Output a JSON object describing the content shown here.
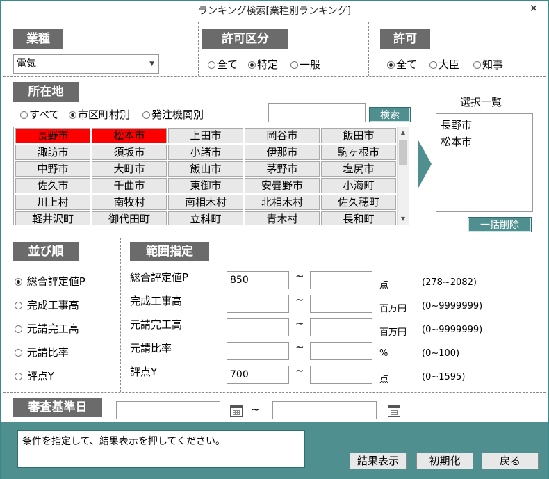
{
  "window": {
    "title": "ランキング検索[業種別ランキング]",
    "close_glyph": "✕"
  },
  "gyoshu": {
    "header": "業種",
    "selected": "電気"
  },
  "kyoka_kubun": {
    "header": "許可区分",
    "options": [
      {
        "label": "全て",
        "checked": false
      },
      {
        "label": "特定",
        "checked": true
      },
      {
        "label": "一般",
        "checked": false
      }
    ]
  },
  "kyoka": {
    "header": "許可",
    "options": [
      {
        "label": "全て",
        "checked": true
      },
      {
        "label": "大臣",
        "checked": false
      },
      {
        "label": "知事",
        "checked": false
      }
    ]
  },
  "shozaichi": {
    "header": "所在地",
    "modes": [
      {
        "label": "すべて",
        "checked": false
      },
      {
        "label": "市区町村別",
        "checked": true
      },
      {
        "label": "発注機関別",
        "checked": false
      }
    ],
    "search_value": "",
    "search_button": "検索",
    "cities": [
      [
        "長野市",
        "松本市",
        "上田市",
        "岡谷市",
        "飯田市"
      ],
      [
        "諏訪市",
        "須坂市",
        "小諸市",
        "伊那市",
        "駒ヶ根市"
      ],
      [
        "中野市",
        "大町市",
        "飯山市",
        "茅野市",
        "塩尻市"
      ],
      [
        "佐久市",
        "千曲市",
        "東御市",
        "安曇野市",
        "小海町"
      ],
      [
        "川上村",
        "南牧村",
        "南相木村",
        "北相木村",
        "佐久穂町"
      ],
      [
        "軽井沢町",
        "御代田町",
        "立科町",
        "青木村",
        "長和町"
      ]
    ],
    "selected_cities": [
      "長野市",
      "松本市"
    ]
  },
  "selection_list": {
    "title": "選択一覧",
    "items": [
      "長野市",
      "松本市"
    ],
    "clear_button": "一括削除"
  },
  "sort": {
    "header": "並び順",
    "options": [
      {
        "label": "総合評定値P",
        "checked": true
      },
      {
        "label": "完成工事高",
        "checked": false
      },
      {
        "label": "元請完工高",
        "checked": false
      },
      {
        "label": "元請比率",
        "checked": false
      },
      {
        "label": "評点Y",
        "checked": false
      }
    ]
  },
  "range": {
    "header": "範囲指定",
    "tilde": "~",
    "rows": [
      {
        "label": "総合評定値P",
        "from": "850",
        "to": "",
        "unit": "点",
        "hint": "(278~2082)"
      },
      {
        "label": "完成工事高",
        "from": "",
        "to": "",
        "unit": "百万円",
        "hint": "(0~9999999)"
      },
      {
        "label": "元請完工高",
        "from": "",
        "to": "",
        "unit": "百万円",
        "hint": "(0~9999999)"
      },
      {
        "label": "元請比率",
        "from": "",
        "to": "",
        "unit": "%",
        "hint": "(0~100)"
      },
      {
        "label": "評点Y",
        "from": "700",
        "to": "",
        "unit": "点",
        "hint": "(0~1595)"
      }
    ]
  },
  "review_date": {
    "header": "審査基準日",
    "from": "",
    "to": "",
    "tilde": "~"
  },
  "footer": {
    "message": "条件を指定して、結果表示を押してください。",
    "buttons": {
      "show": "結果表示",
      "reset": "初期化",
      "back": "戻る"
    }
  },
  "colors": {
    "accent": "#4f8f8f",
    "header_bg": "#6b6b6b",
    "selected_cell": "#ff0000"
  }
}
